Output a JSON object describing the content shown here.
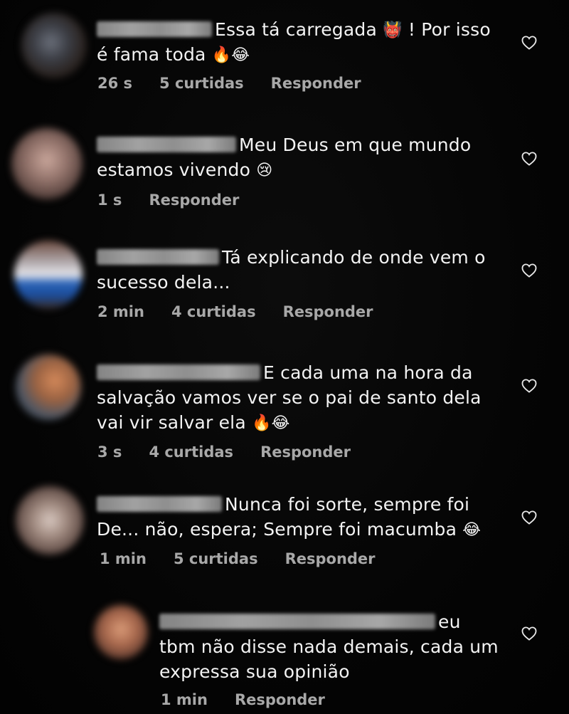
{
  "comments": [
    {
      "text": "Essa tá carregada",
      "emoji1": "👹",
      "text2": "! Por isso",
      "line2": "é fama toda",
      "emojis": "🔥😂",
      "time": "26 s",
      "likes": "5 curtidas",
      "reply": "Responder"
    },
    {
      "text": "Meu Deus em que mundo",
      "line2": "estamos vivendo",
      "emojis": "😢",
      "time": "1 s",
      "reply": "Responder"
    },
    {
      "text": "Tá explicando de onde vem o",
      "line2": "sucesso dela...",
      "time": "2 min",
      "likes": "4 curtidas",
      "reply": "Responder"
    },
    {
      "text": "E cada uma na hora da",
      "line2": "salvação vamos ver se o pai de santo dela",
      "line3": "vai vir salvar ela",
      "emojis": "🔥😂",
      "time": "3 s",
      "likes": "4 curtidas",
      "reply": "Responder"
    },
    {
      "text": "Nunca foi sorte, sempre foi",
      "line2": "De... não, espera; Sempre foi macumba",
      "emojis": "😂",
      "time": "1 min",
      "likes": "5 curtidas",
      "reply": "Responder"
    },
    {
      "text": "eu",
      "line2": "tbm não disse nada demais, cada um",
      "line3": "expressa sua opinião",
      "time": "1 min",
      "reply": "Responder"
    }
  ],
  "icons": {
    "like": "heart-outline-icon"
  },
  "colors": {
    "background": "#030303",
    "text": "#f3f3f3",
    "meta": "#a8a8a8",
    "redacted": "#b0b0b0"
  }
}
